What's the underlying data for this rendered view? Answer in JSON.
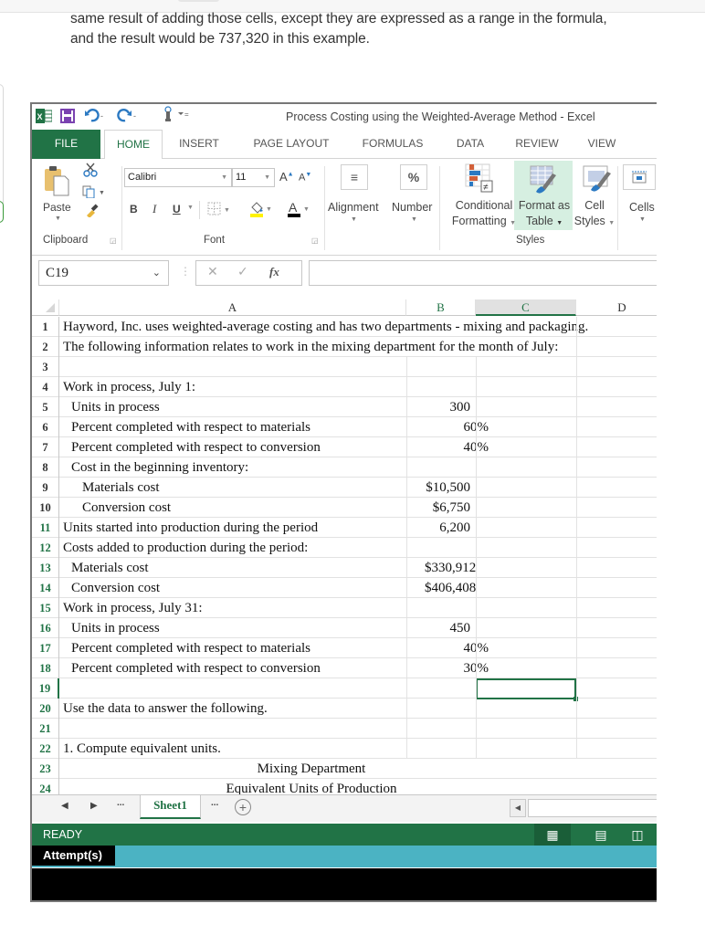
{
  "intro_text": {
    "line1": "same result of adding those cells, except they are expressed as a range in the formula,",
    "line2": "and the result would be 737,320 in this example."
  },
  "excel": {
    "window_title": "Process Costing using the Weighted-Average Method - Excel",
    "quick_access": [
      "excel-logo-icon",
      "save-icon",
      "undo-icon",
      "redo-icon",
      "touch-mode-icon",
      "customize-qat-icon"
    ],
    "tabs": [
      {
        "label": "FILE",
        "state": "file"
      },
      {
        "label": "HOME",
        "state": "active"
      },
      {
        "label": "INSERT"
      },
      {
        "label": "PAGE LAYOUT"
      },
      {
        "label": "FORMULAS"
      },
      {
        "label": "DATA"
      },
      {
        "label": "REVIEW"
      },
      {
        "label": "VIEW"
      }
    ],
    "ribbon": {
      "clipboard": {
        "group_label": "Clipboard",
        "paste_label": "Paste"
      },
      "font": {
        "group_label": "Font",
        "font_name": "Calibri",
        "font_size": "11",
        "bold": "B",
        "italic": "I",
        "underline": "U"
      },
      "alignment": {
        "label": "Alignment"
      },
      "number": {
        "label": "Number",
        "icon_text": "%"
      },
      "styles": {
        "group_label": "Styles",
        "conditional_formatting": [
          "Conditional",
          "Formatting"
        ],
        "format_as_table": [
          "Format as",
          "Table"
        ],
        "cell_styles": [
          "Cell",
          "Styles"
        ]
      },
      "cells": {
        "label": "Cells"
      }
    },
    "formula_bar": {
      "name_box": "C19",
      "cancel_symbol": "✕",
      "enter_symbol": "✓",
      "fx_symbol": "fx",
      "formula_value": ""
    },
    "columns": [
      "A",
      "B",
      "C",
      "D"
    ],
    "selected_column": "C",
    "selected_cell": "C19",
    "rows": [
      {
        "n": "1",
        "a": "Hayword, Inc. uses weighted-average costing and has two departments - mixing and packaging.",
        "indent": 0,
        "b": ""
      },
      {
        "n": "2",
        "a": "The following information relates to work in the mixing department for the month of July:",
        "indent": 0,
        "b": ""
      },
      {
        "n": "3",
        "a": "",
        "indent": 0,
        "b": ""
      },
      {
        "n": "4",
        "a": "Work in process, July 1:",
        "indent": 0,
        "b": ""
      },
      {
        "n": "5",
        "a": "Units in process",
        "indent": 1,
        "b": "300"
      },
      {
        "n": "6",
        "a": "Percent completed with respect to materials",
        "indent": 1,
        "b": "60%"
      },
      {
        "n": "7",
        "a": "Percent completed with respect to conversion",
        "indent": 1,
        "b": "40%"
      },
      {
        "n": "8",
        "a": "Cost in the beginning inventory:",
        "indent": 1,
        "b": ""
      },
      {
        "n": "9",
        "a": "Materials cost",
        "indent": 2,
        "b": "$10,500"
      },
      {
        "n": "10",
        "a": "Conversion cost",
        "indent": 2,
        "b": "$6,750"
      },
      {
        "n": "11",
        "a": "Units started into production during the period",
        "indent": 0,
        "b": "6,200"
      },
      {
        "n": "12",
        "a": "Costs added to production during the period:",
        "indent": 0,
        "b": ""
      },
      {
        "n": "13",
        "a": "Materials cost",
        "indent": 1,
        "b": "$330,912"
      },
      {
        "n": "14",
        "a": "Conversion cost",
        "indent": 1,
        "b": "$406,408"
      },
      {
        "n": "15",
        "a": "Work in process, July 31:",
        "indent": 0,
        "b": ""
      },
      {
        "n": "16",
        "a": "Units in process",
        "indent": 1,
        "b": "450"
      },
      {
        "n": "17",
        "a": "Percent completed with respect to materials",
        "indent": 1,
        "b": "40%"
      },
      {
        "n": "18",
        "a": "Percent completed with respect to conversion",
        "indent": 1,
        "b": "30%"
      },
      {
        "n": "19",
        "a": "",
        "indent": 0,
        "b": ""
      },
      {
        "n": "20",
        "a": "Use the data to answer the following.",
        "indent": 0,
        "b": ""
      },
      {
        "n": "21",
        "a": "",
        "indent": 0,
        "b": ""
      },
      {
        "n": "22",
        "a": "1. Compute equivalent units.",
        "indent": 0,
        "b": ""
      },
      {
        "n": "23",
        "center": "Mixing Department"
      },
      {
        "n": "24",
        "center": "Equivalent Units of Production"
      }
    ],
    "sheet_tabs": {
      "active": "Sheet1",
      "ellipsis": "...",
      "add_symbol": "+"
    },
    "status": {
      "text": "READY"
    },
    "attempts_label": "Attempt(s)"
  }
}
